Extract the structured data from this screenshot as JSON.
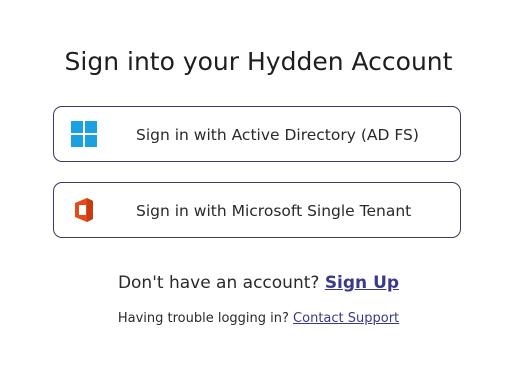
{
  "page": {
    "title": "Sign into your Hydden Account"
  },
  "buttons": [
    {
      "label": "Sign in with Active Directory (AD FS)",
      "icon": "windows-icon"
    },
    {
      "label": "Sign in with Microsoft Single Tenant",
      "icon": "microsoft-office-icon"
    }
  ],
  "signup": {
    "prompt": "Don't have an account?",
    "link": "Sign Up"
  },
  "support": {
    "prompt": "Having trouble logging in?",
    "link": "Contact Support"
  },
  "colors": {
    "border": "#3a3a5e",
    "link": "#3a3a8a",
    "windows_blue": "#1ba1e2",
    "office_red": "#e64a19"
  }
}
